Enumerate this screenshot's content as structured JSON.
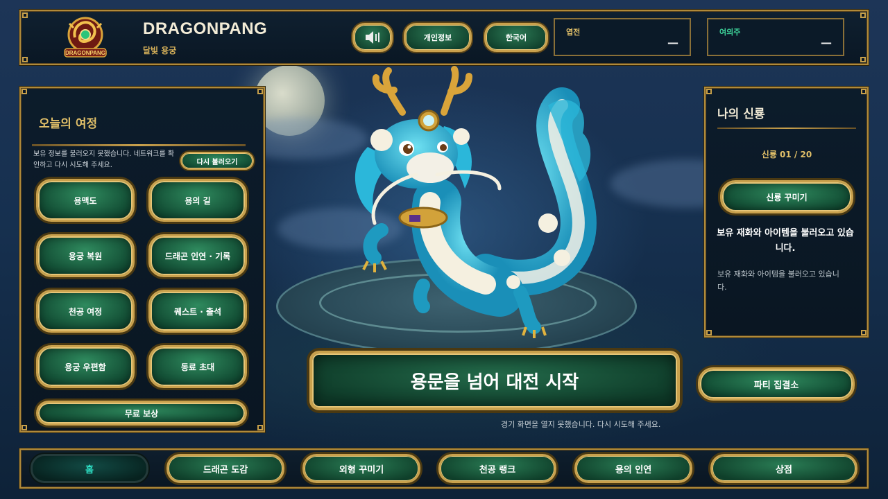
{
  "header": {
    "brand_title": "DRAGONPANG",
    "brand_subtitle": "달빛 용궁",
    "logo_text": "DRAGONPANG",
    "sound_icon": "speaker-icon",
    "profile_label": "개인정보",
    "language_label": "한국어",
    "stat1_label": "엽전",
    "stat1_value": "—",
    "stat2_label": "여의주",
    "stat2_value": "—"
  },
  "left_panel": {
    "title": "오늘의 여정",
    "load_message": "보유 정보를 불러오지 못했습니다. 네트워크를 확인하고 다시 시도해 주세요.",
    "reload_label": "다시 불러오기",
    "buttons": [
      "용맥도",
      "용의 길",
      "용궁 복원",
      "드래곤 인연 · 기록",
      "천공 여정",
      "퀘스트 · 출석",
      "용궁 우편함",
      "동료 초대"
    ],
    "wide_button": "무료 보상"
  },
  "main": {
    "start_label": "용문을 넘어 대전 시작",
    "error_message": "경기 화면을 열지 못했습니다. 다시 시도해 주세요.",
    "party_label": "파티 집결소"
  },
  "right_panel": {
    "title": "나의 신룡",
    "counter": "신룡 01 / 20",
    "decorate_label": "신룡 꾸미기",
    "loading_bold": "보유 재화와 아이템을 불러오고 있습니다.",
    "loading_sub": "보유 재화와 아이템을 불러오고 있습니다."
  },
  "bottom_nav": [
    "홈",
    "드래곤 도감",
    "외형 꾸미기",
    "천공 랭크",
    "용의 인연",
    "상점"
  ],
  "colors": {
    "gold": "#c9a14d",
    "button_green": "#1f6a48",
    "label_gold": "#e2c069",
    "stat2_label": "#3ed39a",
    "active_nav_text": "#2fe3c8"
  }
}
